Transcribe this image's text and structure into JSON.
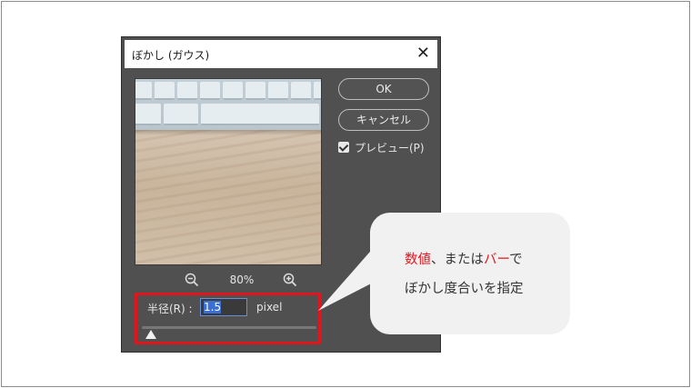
{
  "dialog": {
    "title": "ぼかし (ガウス)",
    "close_symbol": "✕",
    "zoom_level": "80%",
    "ok_label": "OK",
    "cancel_label": "キャンセル",
    "preview_label": "プレビュー(P)",
    "preview_checked": true,
    "radius_label": "半径(R) :",
    "radius_value": "1.5",
    "radius_unit": "pixel",
    "slider_fraction": 0.05
  },
  "icons": {
    "zoom_out": "zoom-out-icon",
    "zoom_in": "zoom-in-icon",
    "close": "close-icon",
    "checkbox": "checkmark-icon"
  },
  "callout": {
    "line1_part1": "数値",
    "line1_part2": "、または",
    "line1_part3": "バー",
    "line1_part4": "で",
    "line2": "ぼかし度合いを指定"
  },
  "colors": {
    "dialog_bg": "#505050",
    "highlight": "#e0161e",
    "callout_bg": "#f1f1f1",
    "input_border": "#6b8fd6"
  }
}
